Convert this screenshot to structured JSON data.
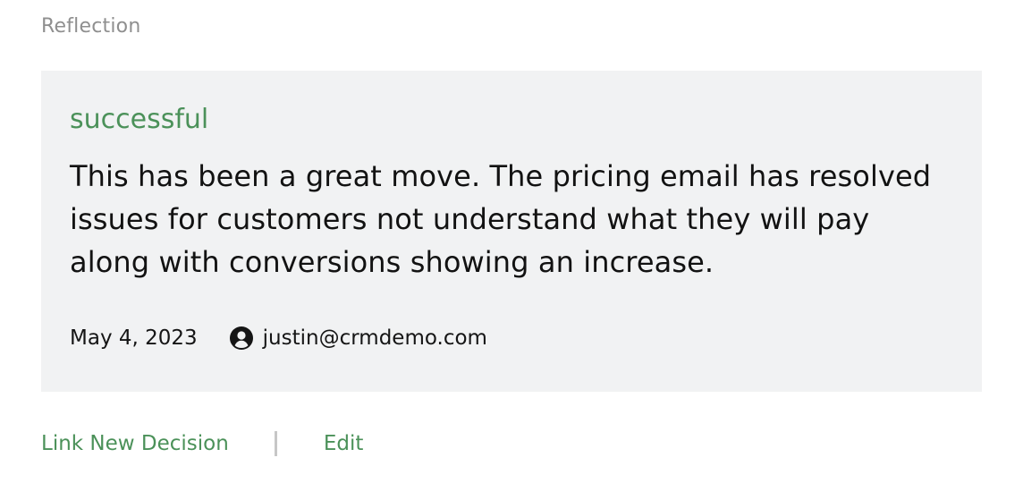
{
  "section": {
    "title": "Reflection"
  },
  "reflection": {
    "status": "successful",
    "text": "This has been a great move. The pricing email has resolved issues for customers not understand what they will pay along with conversions showing an increase.",
    "date": "May 4, 2023",
    "author": "justin@crmdemo.com",
    "author_icon": "user-circle-icon"
  },
  "actions": {
    "link_new_decision": "Link New Decision",
    "edit": "Edit"
  },
  "colors": {
    "accent_green": "#4b9159",
    "card_background": "#f1f2f3",
    "muted_text": "#8f8f8f"
  }
}
